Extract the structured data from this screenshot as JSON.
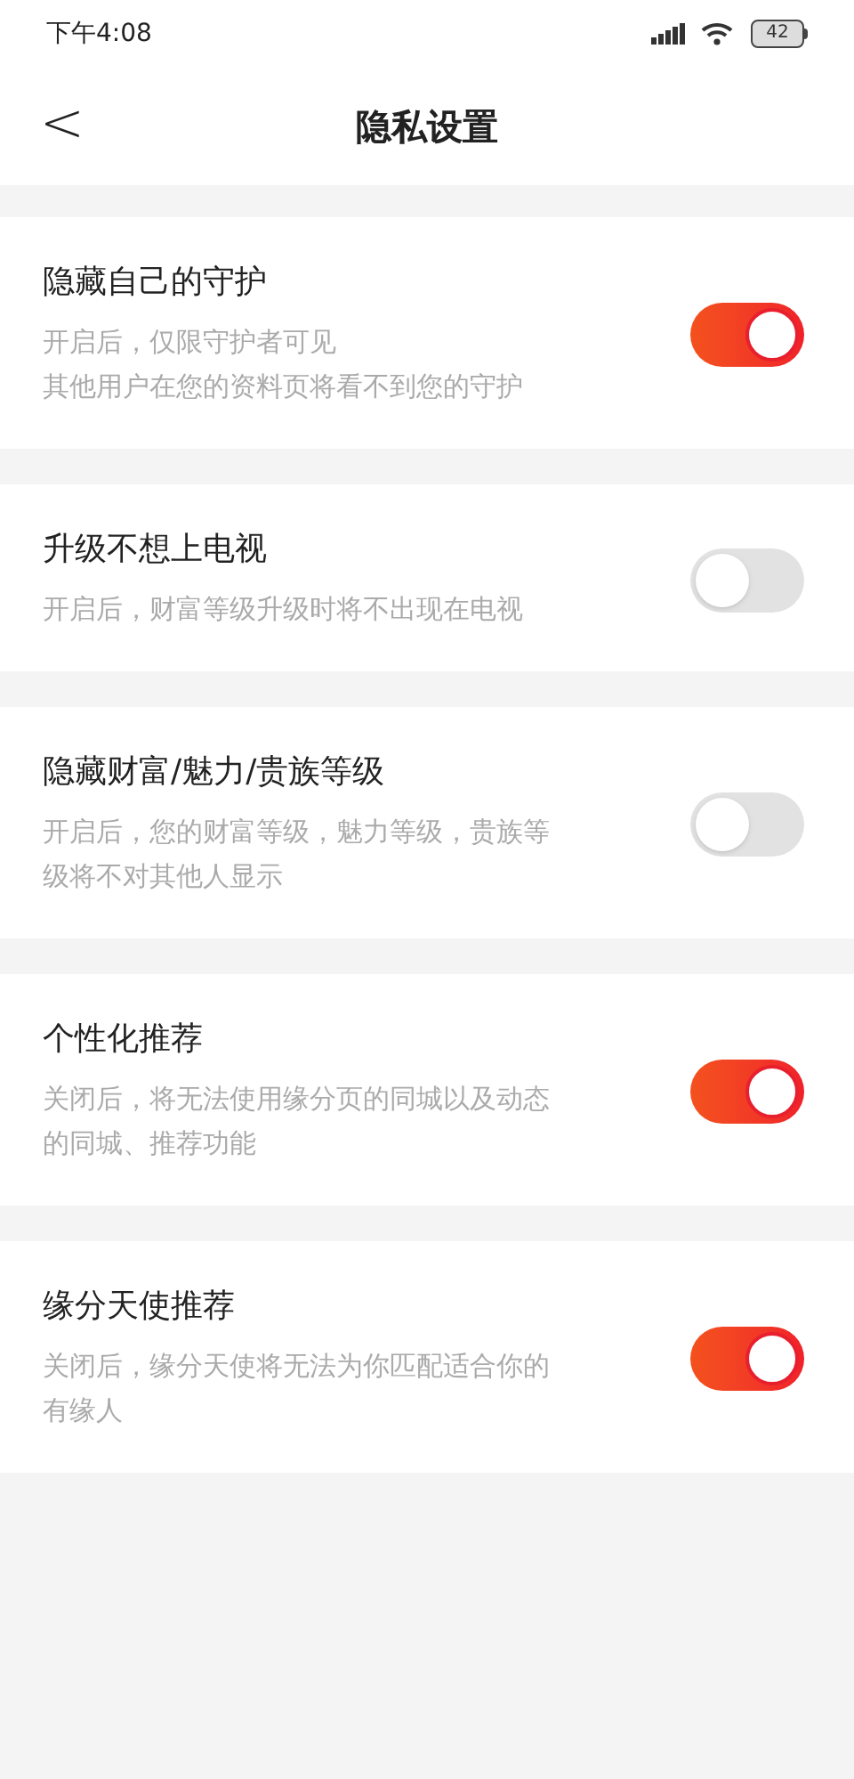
{
  "status_bar": {
    "time": "下午4:08",
    "battery": "42"
  },
  "header": {
    "back": "<",
    "title": "隐私设置"
  },
  "settings": [
    {
      "title": "隐藏自己的守护",
      "description": [
        "开启后，仅限守护者可见",
        "其他用户在您的资料页将看不到您的守护"
      ],
      "on": true
    },
    {
      "title": "升级不想上电视",
      "description": [
        "开启后，财富等级升级时将不出现在电视"
      ],
      "on": false
    },
    {
      "title": "隐藏财富/魅力/贵族等级",
      "description": [
        "开启后，您的财富等级，魅力等级，贵族等",
        "级将不对其他人显示"
      ],
      "on": false
    },
    {
      "title": "个性化推荐",
      "description": [
        "关闭后，将无法使用缘分页的同城以及动态",
        "的同城、推荐功能"
      ],
      "on": true
    },
    {
      "title": "缘分天使推荐",
      "description": [
        "关闭后，缘分天使将无法为你匹配适合你的",
        "有缘人"
      ],
      "on": true
    }
  ]
}
